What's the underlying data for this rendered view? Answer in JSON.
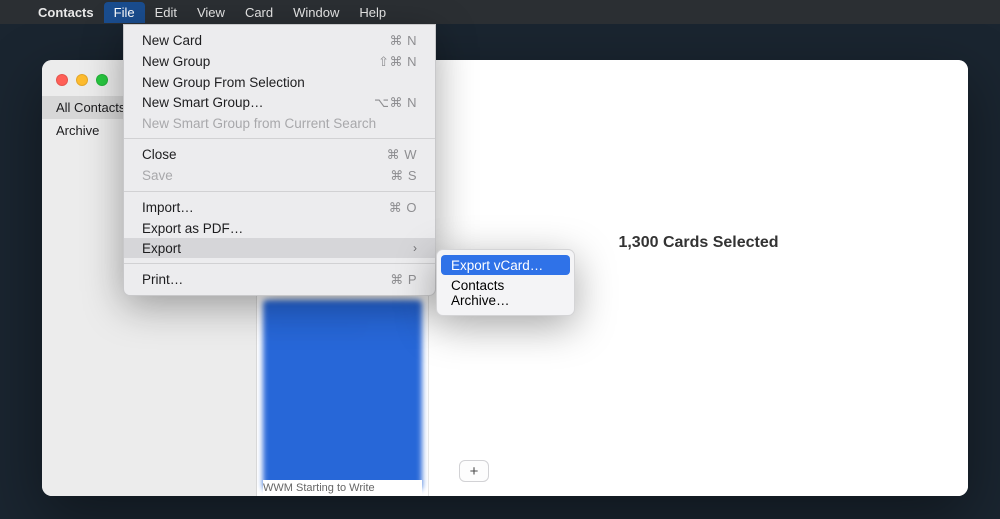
{
  "menubar": {
    "app": "Contacts",
    "items": [
      "File",
      "Edit",
      "View",
      "Card",
      "Window",
      "Help"
    ],
    "open_index": 0
  },
  "file_menu": {
    "new_card": "New Card",
    "new_card_sc": "⌘ N",
    "new_group": "New Group",
    "new_group_sc": "⇧⌘ N",
    "new_group_sel": "New Group From Selection",
    "new_smart": "New Smart Group…",
    "new_smart_sc": "⌥⌘ N",
    "new_smart_search": "New Smart Group from Current Search",
    "close": "Close",
    "close_sc": "⌘ W",
    "save": "Save",
    "save_sc": "⌘ S",
    "import": "Import…",
    "import_sc": "⌘ O",
    "export_pdf": "Export as PDF…",
    "export": "Export",
    "print": "Print…",
    "print_sc": "⌘ P"
  },
  "export_submenu": {
    "vcard": "Export vCard…",
    "archive": "Contacts Archive…"
  },
  "sidebar": {
    "all": "All Contacts",
    "archive": "Archive"
  },
  "detail": {
    "title": "1,300 Cards Selected"
  },
  "clist": {
    "bottom_peek": "WWM Starting to Write"
  }
}
